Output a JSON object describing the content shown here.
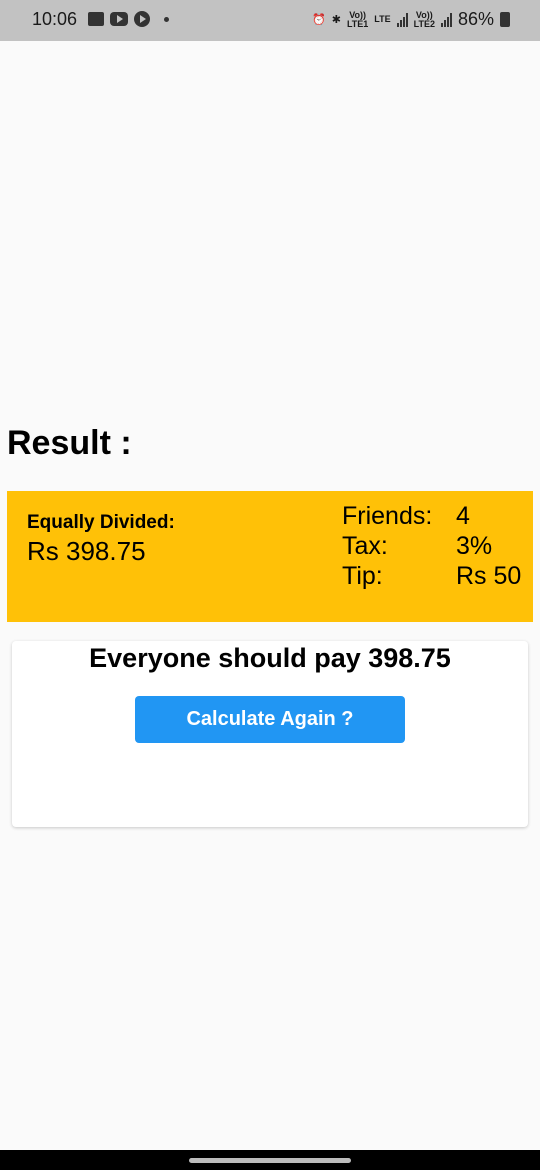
{
  "status_bar": {
    "time": "10:06",
    "volte1": "Vo))",
    "lte1": "LTE1",
    "lte_label": "LTE",
    "volte2": "Vo))",
    "lte2": "LTE2",
    "battery": "86%"
  },
  "result": {
    "title": "Result :"
  },
  "summary": {
    "equally_divided_label": "Equally Divided:",
    "equally_divided_value": "Rs 398.75",
    "friends_label": "Friends:",
    "friends_value": "4",
    "tax_label": "Tax:",
    "tax_value": "3%",
    "tip_label": "Tip:",
    "tip_value": "Rs 50",
    "background_color": "#ffc107"
  },
  "card": {
    "message": "Everyone should pay 398.75",
    "button_label": "Calculate Again ?",
    "button_color": "#2196f3"
  }
}
